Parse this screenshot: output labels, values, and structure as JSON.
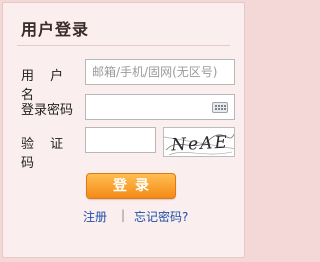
{
  "panel": {
    "title": "用户登录"
  },
  "form": {
    "username_label": "用 户 名",
    "username_placeholder": "邮箱/手机/固网(无区号)",
    "password_label": "登录密码",
    "captcha_label": "验 证 码",
    "captcha_text": "NeAE"
  },
  "actions": {
    "login_label": "登录",
    "register_label": "注册",
    "separator": "|",
    "forgot_label": "忘记密码?"
  },
  "icons": {
    "keyboard": "keyboard-icon"
  },
  "colors": {
    "background": "#f4d8d8",
    "panel": "#fbeeee",
    "button_top": "#ffbe52",
    "button_bottom": "#f48a17",
    "link": "#1d4fa7"
  }
}
